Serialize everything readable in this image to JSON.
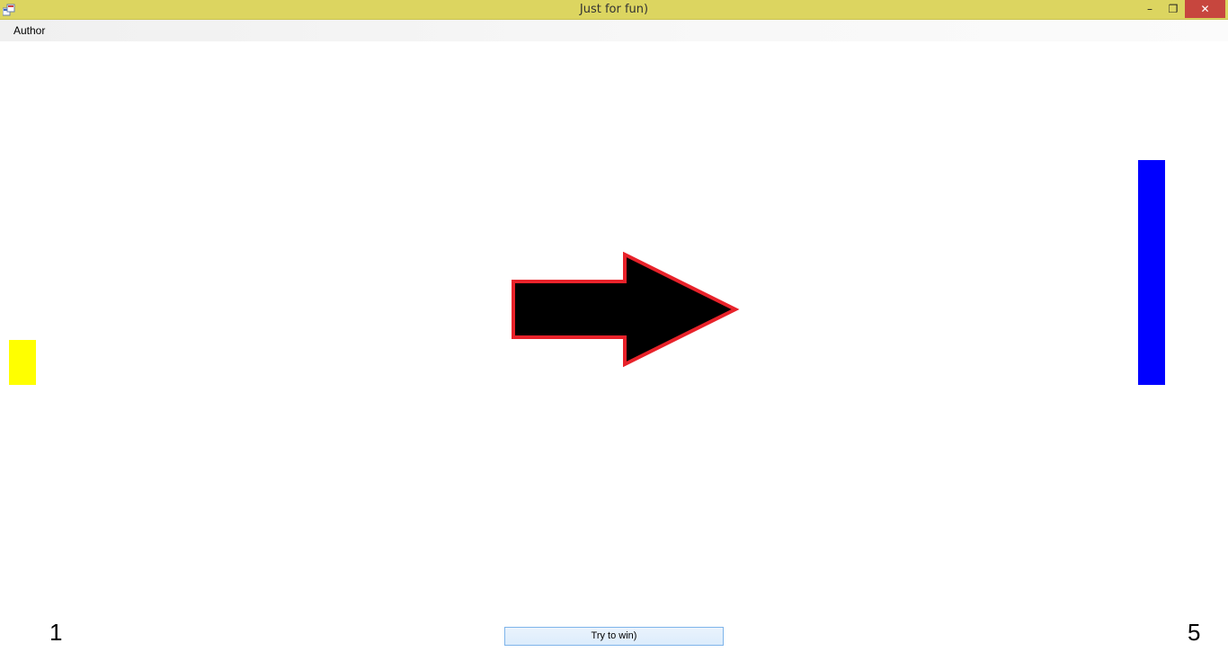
{
  "window": {
    "title": "Just for fun)",
    "minimize_glyph": "–",
    "maximize_glyph": "❐",
    "close_glyph": "✕",
    "app_icon": "windows-form-icon"
  },
  "menu": {
    "items": [
      {
        "label": "Author"
      }
    ]
  },
  "game": {
    "left_paddle_color": "#ffff00",
    "right_paddle_color": "#0000ff",
    "arrow_fill": "#000000",
    "arrow_stroke": "#e8222a",
    "arrow_direction": "right",
    "scores": {
      "left": "1",
      "right": "5"
    },
    "button_label": "Try to win)"
  }
}
